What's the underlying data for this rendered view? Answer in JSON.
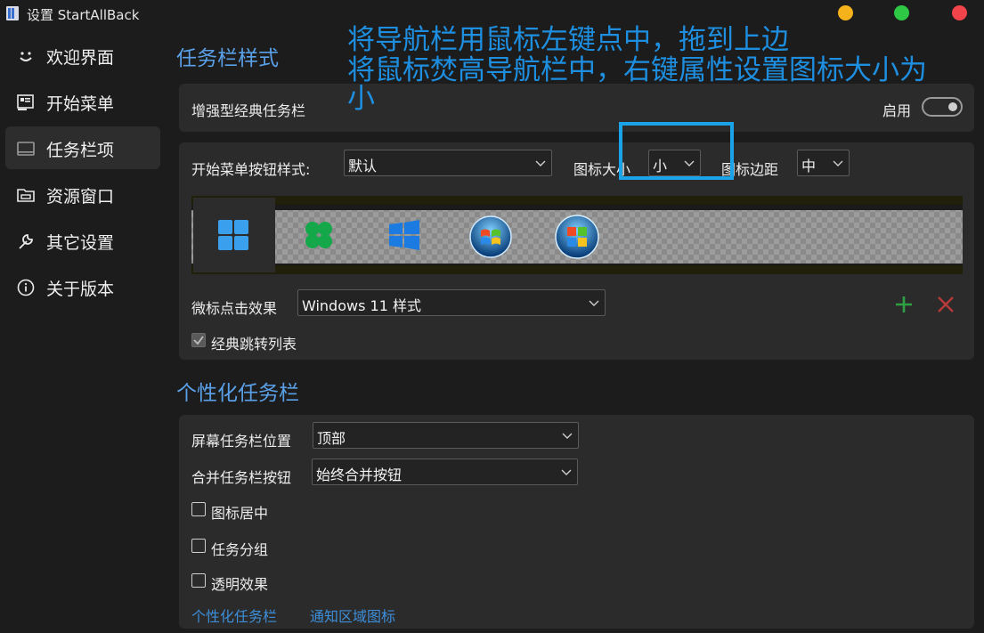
{
  "window": {
    "title": "设置 StartAllBack"
  },
  "sidebar": {
    "items": [
      {
        "label": "欢迎界面",
        "icon": "smile-icon"
      },
      {
        "label": "开始菜单",
        "icon": "start-menu-icon"
      },
      {
        "label": "任务栏项",
        "icon": "taskbar-icon",
        "active": true
      },
      {
        "label": "资源窗口",
        "icon": "folder-icon"
      },
      {
        "label": "其它设置",
        "icon": "wrench-icon"
      },
      {
        "label": "关于版本",
        "icon": "info-icon"
      }
    ]
  },
  "taskbar_section": {
    "title": "任务栏样式",
    "enhanced_label": "增强型经典任务栏",
    "enable_label": "启用",
    "start_button_style_label": "开始菜单按钮样式:",
    "start_button_style_value": "默认",
    "icon_size_label": "图标大小",
    "icon_size_value": "小",
    "icon_margin_label": "图标边距",
    "icon_margin_value": "中",
    "click_effect_label": "微标点击效果",
    "click_effect_value": "Windows 11 样式",
    "jump_list_label": "经典跳转列表"
  },
  "personalize_section": {
    "title": "个性化任务栏",
    "position_label": "屏幕任务栏位置",
    "position_value": "顶部",
    "combine_label": "合并任务栏按钮",
    "combine_value": "始终合并按钮",
    "center_icons_label": "图标居中",
    "group_label": "任务分组",
    "transparent_label": "透明效果",
    "link_personalize": "个性化任务栏",
    "link_tray": "通知区域图标"
  },
  "annotation": {
    "line1": "将导航栏用鼠标左键点中，拖到上边",
    "line2": "将鼠标焚高导航栏中，右键属性设置图标大小为",
    "line3": "小"
  },
  "colors": {
    "accent": "#5aa0e8",
    "annotation": "#1e8fe0",
    "highlight": "#1aa3e8",
    "win_min": "#f6b21b",
    "win_max": "#2ec845",
    "win_close": "#f0444a",
    "add": "#2ea043",
    "remove": "#b83a3a"
  }
}
